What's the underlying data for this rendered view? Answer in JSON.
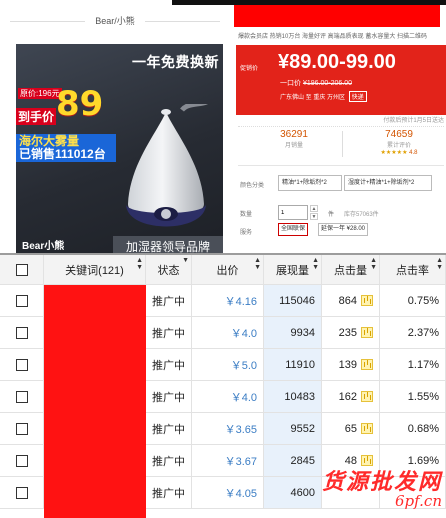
{
  "brand": {
    "name": "Bear/小熊"
  },
  "image": {
    "offer": "一年免费换新",
    "price_old": "原价:196元",
    "price_big": "89",
    "price_unit": "到手价",
    "sales_line1": "海尔大雾量",
    "sales_line2": "已销售111012台",
    "logo": "Bear小熊",
    "caption": "加湿器领导品牌"
  },
  "detail": {
    "tags": "爆款会员店  热销10万台  海量好评  高端品质表现  蓄水容量大  扫描二维码",
    "price_label": "促销价",
    "price": "¥89.00-99.00",
    "price_orig_prefix": "一口价",
    "price_orig": "¥196.00-206.00",
    "location": "广东佛山  至  重庆  万州区",
    "location_badge": "快递",
    "notice": "付款后预计1月5日送达",
    "sales_count": "36291",
    "sales_label": "月销量",
    "reviews_count": "74659",
    "reviews_label": "累计评价",
    "rating": "4.8",
    "opt_label": "颜色分类",
    "options": [
      "精油*1+除垢剂*2",
      "湿度计+精油*1+除垢剂*2"
    ],
    "qty_label": "数量",
    "qty_value": "1",
    "qty_unit": "件",
    "stock": "库存57063件",
    "service_label": "服务",
    "service_a": "全国联保",
    "service_b": "延保一年 ¥28.00"
  },
  "table": {
    "headers": {
      "keyword": "关键词(121)",
      "status": "状态",
      "bid": "出价",
      "impressions": "展现量",
      "clicks": "点击量",
      "ctr": "点击率"
    },
    "rows": [
      {
        "status": "推广中",
        "bid": "￥4.16",
        "impressions": "115046",
        "clicks": "864",
        "ctr": "0.75%"
      },
      {
        "status": "推广中",
        "bid": "￥4.0",
        "impressions": "9934",
        "clicks": "235",
        "ctr": "2.37%"
      },
      {
        "status": "推广中",
        "bid": "￥5.0",
        "impressions": "11910",
        "clicks": "139",
        "ctr": "1.17%"
      },
      {
        "status": "推广中",
        "bid": "￥4.0",
        "impressions": "10483",
        "clicks": "162",
        "ctr": "1.55%"
      },
      {
        "status": "推广中",
        "bid": "￥3.65",
        "impressions": "9552",
        "clicks": "65",
        "ctr": "0.68%"
      },
      {
        "status": "推广中",
        "bid": "￥3.67",
        "impressions": "2845",
        "clicks": "48",
        "ctr": "1.69%"
      },
      {
        "status": "推广中",
        "bid": "￥4.05",
        "impressions": "4600",
        "clicks": "",
        "ctr": ""
      }
    ]
  },
  "watermark": {
    "text": "货源批发网",
    "url": "6pf.cn"
  },
  "colors": {
    "accent_red": "#e2231a",
    "link_blue": "#3b7dc4",
    "impression_bg": "#e8f1fb"
  }
}
